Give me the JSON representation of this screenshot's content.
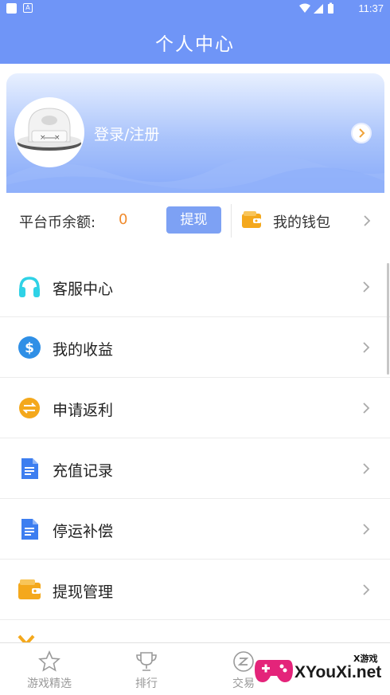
{
  "status_bar": {
    "time": "11:37"
  },
  "header": {
    "title": "个人中心"
  },
  "profile": {
    "login_label": "登录/注册"
  },
  "balance": {
    "label": "平台币余额:",
    "value": "0",
    "withdraw_label": "提现",
    "wallet_label": "我的钱包"
  },
  "menu": [
    {
      "label": "客服中心",
      "icon": "headphones-icon",
      "color": "#2fd2e6"
    },
    {
      "label": "我的收益",
      "icon": "dollar-icon",
      "color": "#2f8fe6"
    },
    {
      "label": "申请返利",
      "icon": "exchange-icon",
      "color": "#f4a81c"
    },
    {
      "label": "充值记录",
      "icon": "document-icon",
      "color": "#3d7ef0"
    },
    {
      "label": "停运补偿",
      "icon": "document-icon",
      "color": "#3d7ef0"
    },
    {
      "label": "提现管理",
      "icon": "wallet-icon",
      "color": "#f4a81c"
    }
  ],
  "tabs": [
    {
      "label": "游戏精选",
      "icon": "star-icon"
    },
    {
      "label": "排行",
      "icon": "trophy-icon"
    },
    {
      "label": "交易",
      "icon": "trade-icon"
    }
  ],
  "watermark": {
    "top_text": "X游戏",
    "main_text": "XYouXi.net"
  },
  "colors": {
    "primary": "#6f95f7",
    "accent_orange": "#f08a2c",
    "button_blue": "#7da1f4"
  }
}
